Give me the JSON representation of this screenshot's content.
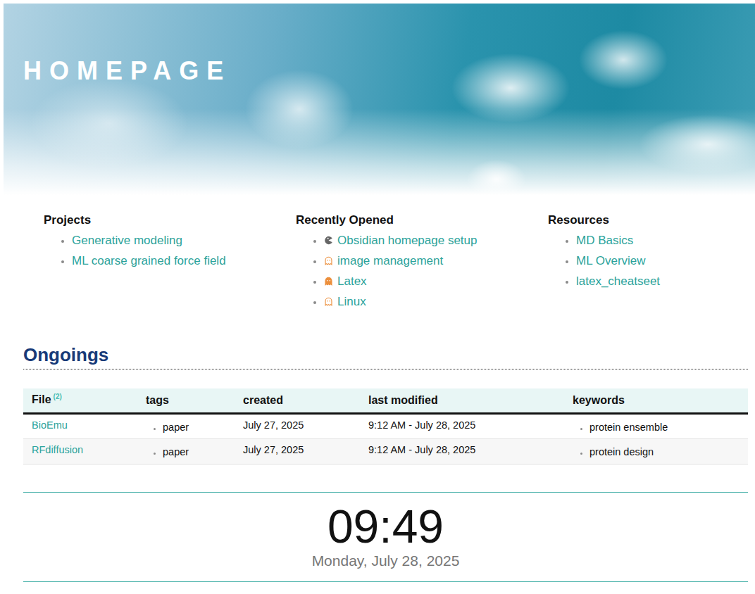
{
  "banner": {
    "title": "HOMEPAGE"
  },
  "lists": [
    {
      "heading": "Projects",
      "items": [
        {
          "label": "Generative modeling"
        },
        {
          "label": "ML coarse grained force field"
        }
      ]
    },
    {
      "heading": "Recently Opened",
      "items": [
        {
          "label": "Obsidian homepage setup",
          "kind": "pacman"
        },
        {
          "label": "image management",
          "kind": "ghost"
        },
        {
          "label": "Latex",
          "kind": "ghostsolid"
        },
        {
          "label": "Linux",
          "kind": "ghost"
        }
      ]
    },
    {
      "heading": "Resources",
      "items": [
        {
          "label": "MD Basics"
        },
        {
          "label": "ML Overview"
        },
        {
          "label": "latex_cheatseet"
        }
      ]
    }
  ],
  "ongoings": {
    "heading": "Ongoings",
    "table": {
      "columns": [
        "File",
        "tags",
        "created",
        "last modified",
        "keywords"
      ],
      "file_count": "(2)",
      "rows": [
        {
          "file": "BioEmu",
          "tags": [
            "paper"
          ],
          "created": "July 27, 2025",
          "modified": "9:12 AM - July 28, 2025",
          "keywords": [
            "protein ensemble"
          ]
        },
        {
          "file": "RFdiffusion",
          "tags": [
            "paper"
          ],
          "created": "July 27, 2025",
          "modified": "9:12 AM - July 28, 2025",
          "keywords": [
            "protein design"
          ]
        }
      ]
    }
  },
  "clock": {
    "time": "09:49",
    "date": "Monday, July 28, 2025"
  }
}
